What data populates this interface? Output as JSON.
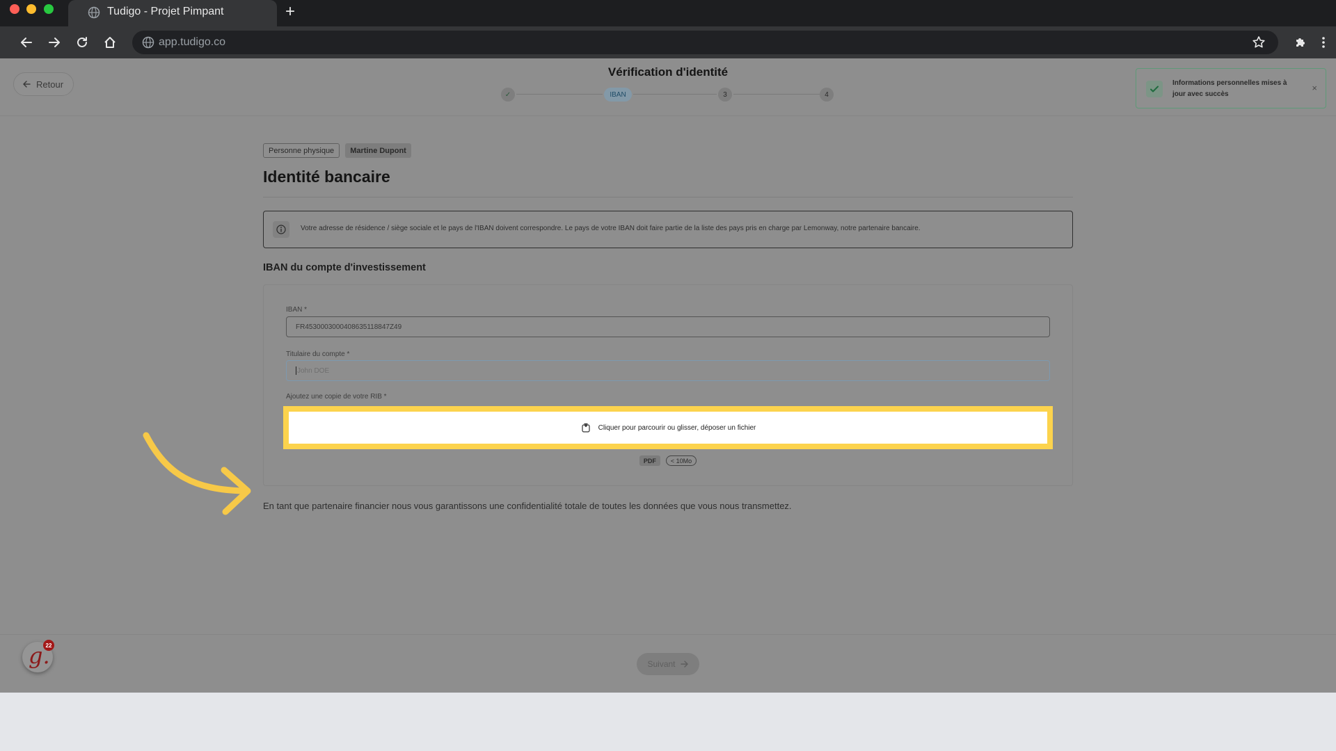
{
  "browser": {
    "tab_title": "Tudigo - Projet Pimpant",
    "new_tab_label": "+",
    "url": "app.tudigo.co"
  },
  "header": {
    "back_label": "Retour",
    "title": "Vérification d'identité",
    "steps": [
      {
        "label": "✓",
        "state": "done"
      },
      {
        "label": "IBAN",
        "state": "current"
      },
      {
        "label": "3",
        "state": "todo"
      },
      {
        "label": "4",
        "state": "todo"
      }
    ]
  },
  "toast": {
    "message": "Informations personnelles mises à jour avec succès",
    "close_label": "×"
  },
  "content": {
    "tags": [
      "Personne physique",
      "Martine Dupont"
    ],
    "title": "Identité bancaire",
    "info_text": "Votre adresse de résidence / siège sociale et le pays de l'IBAN doivent correspondre. Le pays de votre IBAN doit faire partie de la liste des pays pris en charge par Lemonway, notre partenaire bancaire.",
    "section_title": "IBAN du compte d'investissement",
    "iban": {
      "label": "IBAN *",
      "value": "FR4530003000408635118847Z49"
    },
    "holder": {
      "label": "Titulaire du compte *",
      "placeholder": "John DOE"
    },
    "rib": {
      "label": "Ajoutez une copie de votre RIB *",
      "dropzone_text": "Cliquer pour parcourir ou glisser, déposer un fichier",
      "format_badge": "PDF",
      "size_badge": "< 10Mo"
    },
    "footnote": "En tant que partenaire financier nous vous garantissons une confidentialité totale de toutes les données que vous nous transmettez."
  },
  "footer": {
    "next_label": "Suivant",
    "logo_letter": "g.",
    "logo_badge": "22"
  },
  "colors": {
    "highlight": "#fcd34d",
    "arrow": "#f7c948",
    "toast_border": "#5e9a78"
  }
}
